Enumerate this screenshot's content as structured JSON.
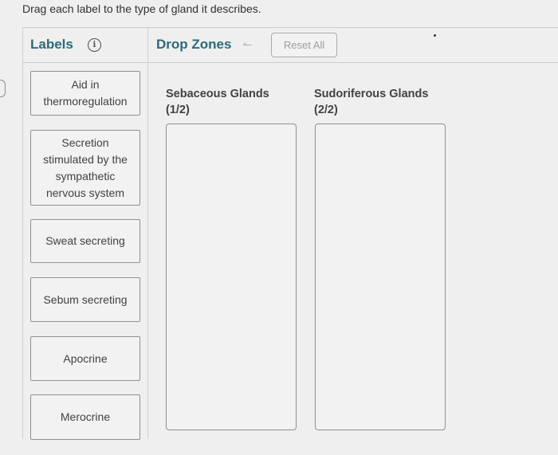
{
  "instructions": "Drag each label to the type of gland it describes.",
  "header": {
    "labels_title": "Labels",
    "info_icon": "info-icon",
    "drop_zones_title": "Drop Zones",
    "undo_icon": "undo-arrow-icon",
    "undo_glyph": "↼",
    "reset_label": "Reset All"
  },
  "labels": [
    {
      "text": "Aid in thermoregulation"
    },
    {
      "text": "Secretion stimulated by the sympathetic nervous system"
    },
    {
      "text": "Sweat secreting"
    },
    {
      "text": "Sebum secreting"
    },
    {
      "text": "Apocrine"
    },
    {
      "text": "Merocrine"
    }
  ],
  "drop_zones": [
    {
      "title": "Sebaceous Glands",
      "count": "(1/2)"
    },
    {
      "title": "Sudoriferous Glands",
      "count": "(2/2)"
    }
  ],
  "colors": {
    "accent": "#2e6a7c",
    "background": "#eeefee",
    "border": "#8d9295"
  }
}
